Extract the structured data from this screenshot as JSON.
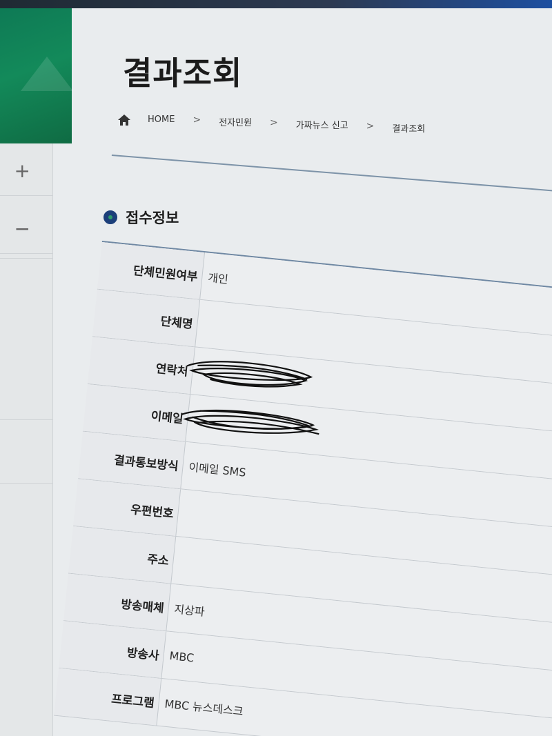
{
  "page": {
    "title": "결과조회"
  },
  "breadcrumb": {
    "home": "HOME",
    "items": [
      "전자민원",
      "가짜뉴스 신고",
      "결과조회"
    ],
    "separator": ">"
  },
  "sidebar": {
    "expand_label": "+",
    "collapse_label": "−"
  },
  "section": {
    "title": "접수정보"
  },
  "rows": [
    {
      "label": "단체민원여부",
      "value": "개인"
    },
    {
      "label": "단체명",
      "value": ""
    },
    {
      "label": "연락처",
      "value": "",
      "redacted": true
    },
    {
      "label": "이메일",
      "value": "",
      "redacted": true
    },
    {
      "label": "결과통보방식",
      "value": "이메일 SMS"
    },
    {
      "label": "우편번호",
      "value": ""
    },
    {
      "label": "주소",
      "value": ""
    },
    {
      "label": "방송매체",
      "value": "지상파"
    },
    {
      "label": "방송사",
      "value": "MBC"
    },
    {
      "label": "프로그램",
      "value": "MBC 뉴스데스크"
    }
  ],
  "colors": {
    "accent_blue": "#1c3f7a",
    "accent_green": "#138a5a",
    "rule": "#6f88a3"
  }
}
